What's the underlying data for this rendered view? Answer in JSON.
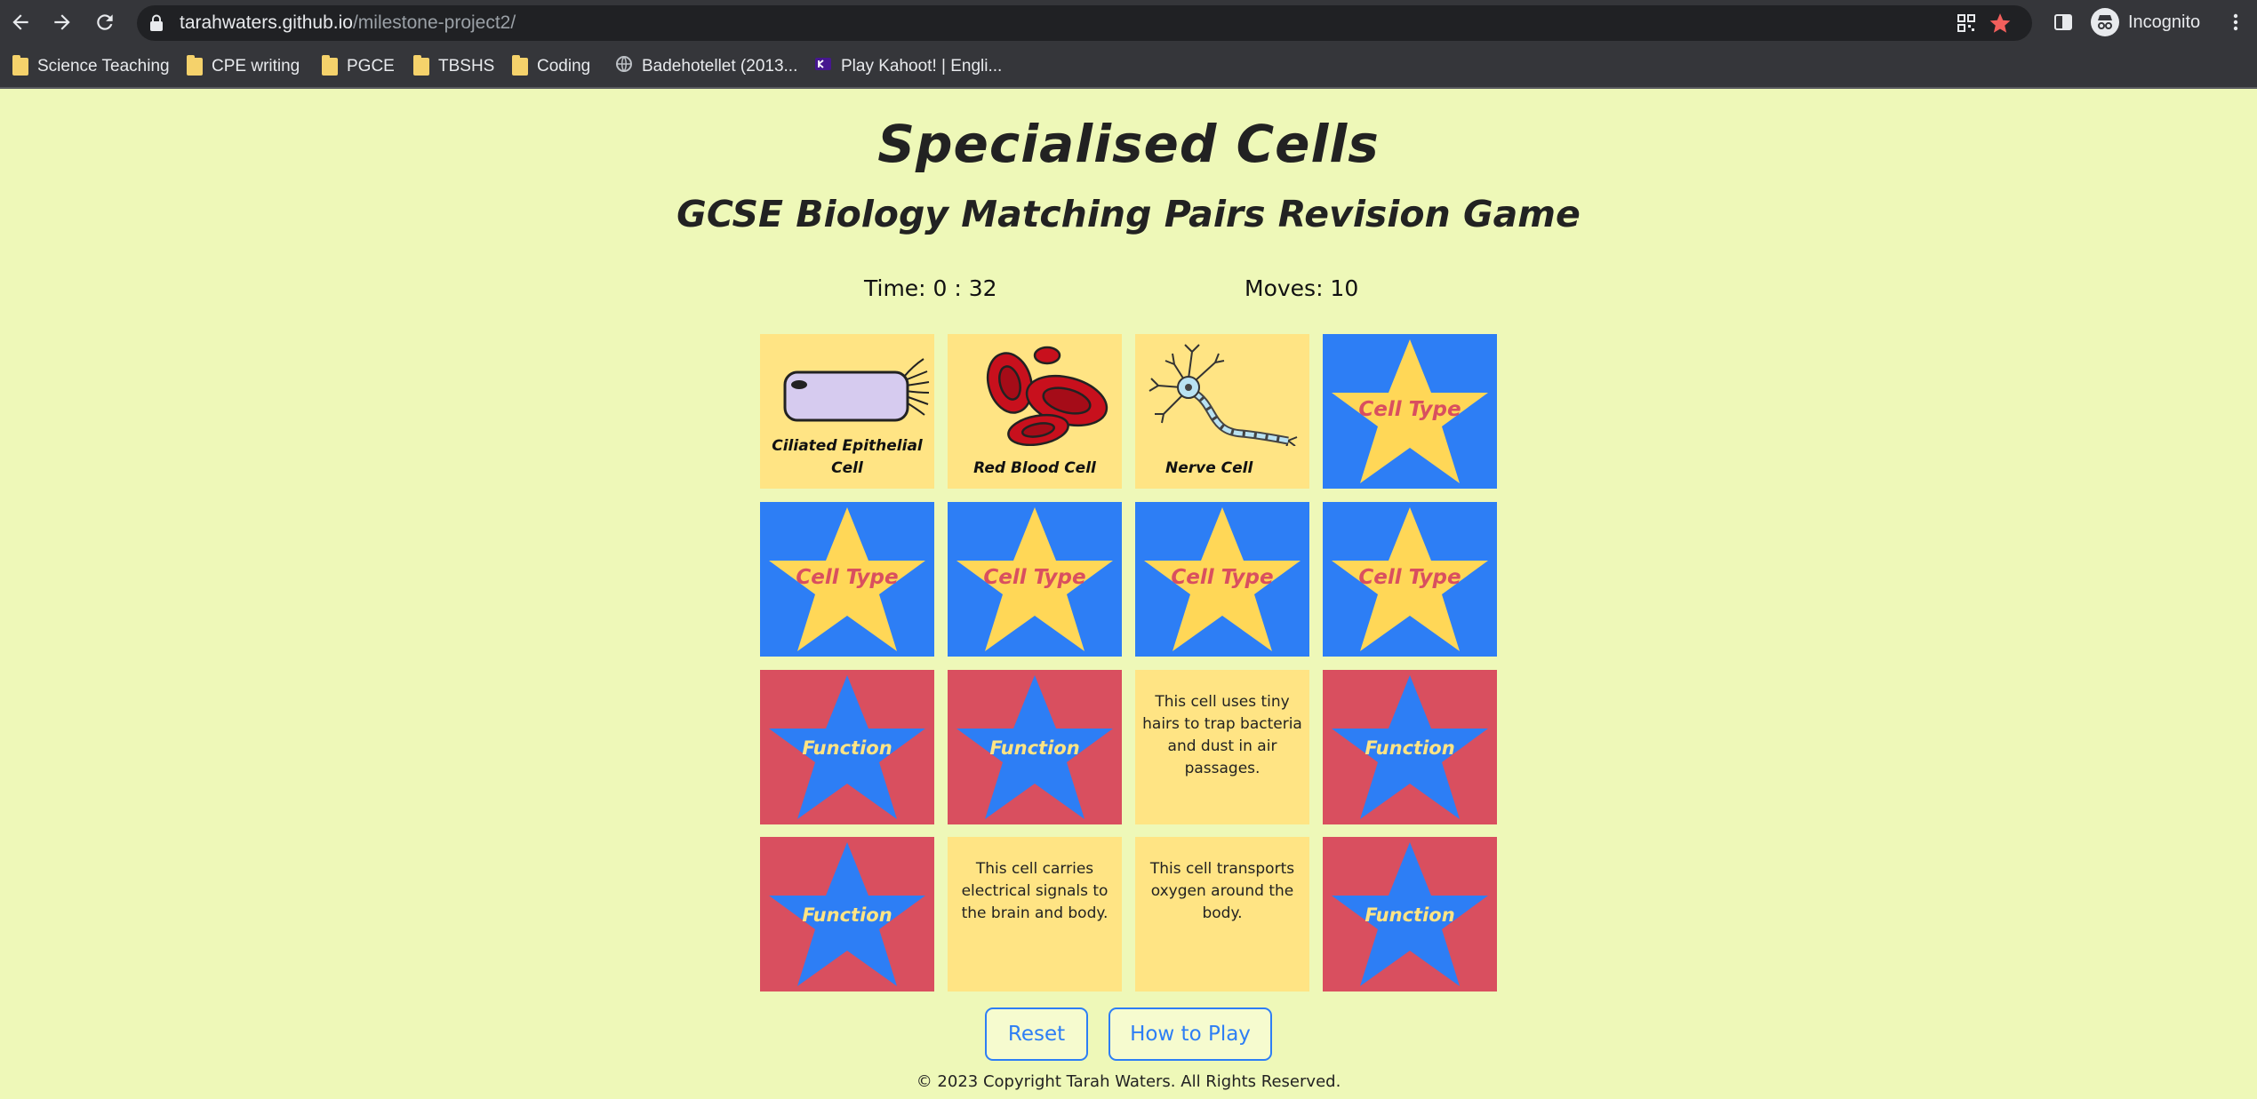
{
  "browser": {
    "url_host": "tarahwaters.github.io",
    "url_path": "/milestone-project2/",
    "profile_label": "Incognito",
    "icons": [
      "back-arrow-icon",
      "forward-arrow-icon",
      "reload-icon",
      "lock-icon",
      "qr-code-icon",
      "bookmark-star-icon",
      "side-panel-icon",
      "incognito-icon",
      "more-menu-icon"
    ],
    "bookmarks": [
      {
        "label": "Science Teaching",
        "icon": "folder-icon"
      },
      {
        "label": "CPE writing",
        "icon": "folder-icon"
      },
      {
        "label": "PGCE",
        "icon": "folder-icon"
      },
      {
        "label": "TBSHS",
        "icon": "folder-icon"
      },
      {
        "label": "Coding",
        "icon": "folder-icon"
      },
      {
        "label": "Badehotellet (2013...",
        "icon": "globe-icon"
      },
      {
        "label": "Play Kahoot! | Engli...",
        "icon": "kahoot-icon"
      }
    ]
  },
  "page": {
    "title": "Specialised Cells",
    "subtitle": "GCSE Biology Matching Pairs Revision Game",
    "time_label": "Time: 0 : 32",
    "moves_label": "Moves: 10",
    "cards": {
      "r1c1": {
        "state": "face-up",
        "label": "Ciliated Epithelial Cell",
        "image": "ciliated-cell-illustration"
      },
      "r1c2": {
        "state": "face-up",
        "label": "Red Blood Cell",
        "image": "red-blood-cell-illustration"
      },
      "r1c3": {
        "state": "face-up",
        "label": "Nerve Cell",
        "image": "nerve-cell-illustration"
      },
      "r1c4": {
        "state": "face-down",
        "label": "Cell Type"
      },
      "r2c1": {
        "state": "face-down",
        "label": "Cell Type"
      },
      "r2c2": {
        "state": "face-down",
        "label": "Cell Type"
      },
      "r2c3": {
        "state": "face-down",
        "label": "Cell Type"
      },
      "r2c4": {
        "state": "face-down",
        "label": "Cell Type"
      },
      "r3c1": {
        "state": "face-down",
        "label": "Function"
      },
      "r3c2": {
        "state": "face-down",
        "label": "Function"
      },
      "r3c3": {
        "state": "face-up",
        "label": "This cell uses tiny hairs to trap bacteria and dust in air passages."
      },
      "r3c4": {
        "state": "face-down",
        "label": "Function"
      },
      "r4c1": {
        "state": "face-down",
        "label": "Function"
      },
      "r4c2": {
        "state": "face-up",
        "label": "This cell carries electrical signals to the brain and body."
      },
      "r4c3": {
        "state": "face-up",
        "label": "This cell transports oxygen around the body."
      },
      "r4c4": {
        "state": "face-down",
        "label": "Function"
      }
    },
    "reset_label": "Reset",
    "how_to_play_label": "How to Play",
    "footer": "© 2023 Copyright Tarah Waters. All Rights Reserved."
  },
  "colors": {
    "page_background": "#eef8b8",
    "card_face": "#ffe484",
    "cell_type_back": "#2d7ef5",
    "function_back": "#d94f5f",
    "button_accent": "#2d7ef5"
  }
}
